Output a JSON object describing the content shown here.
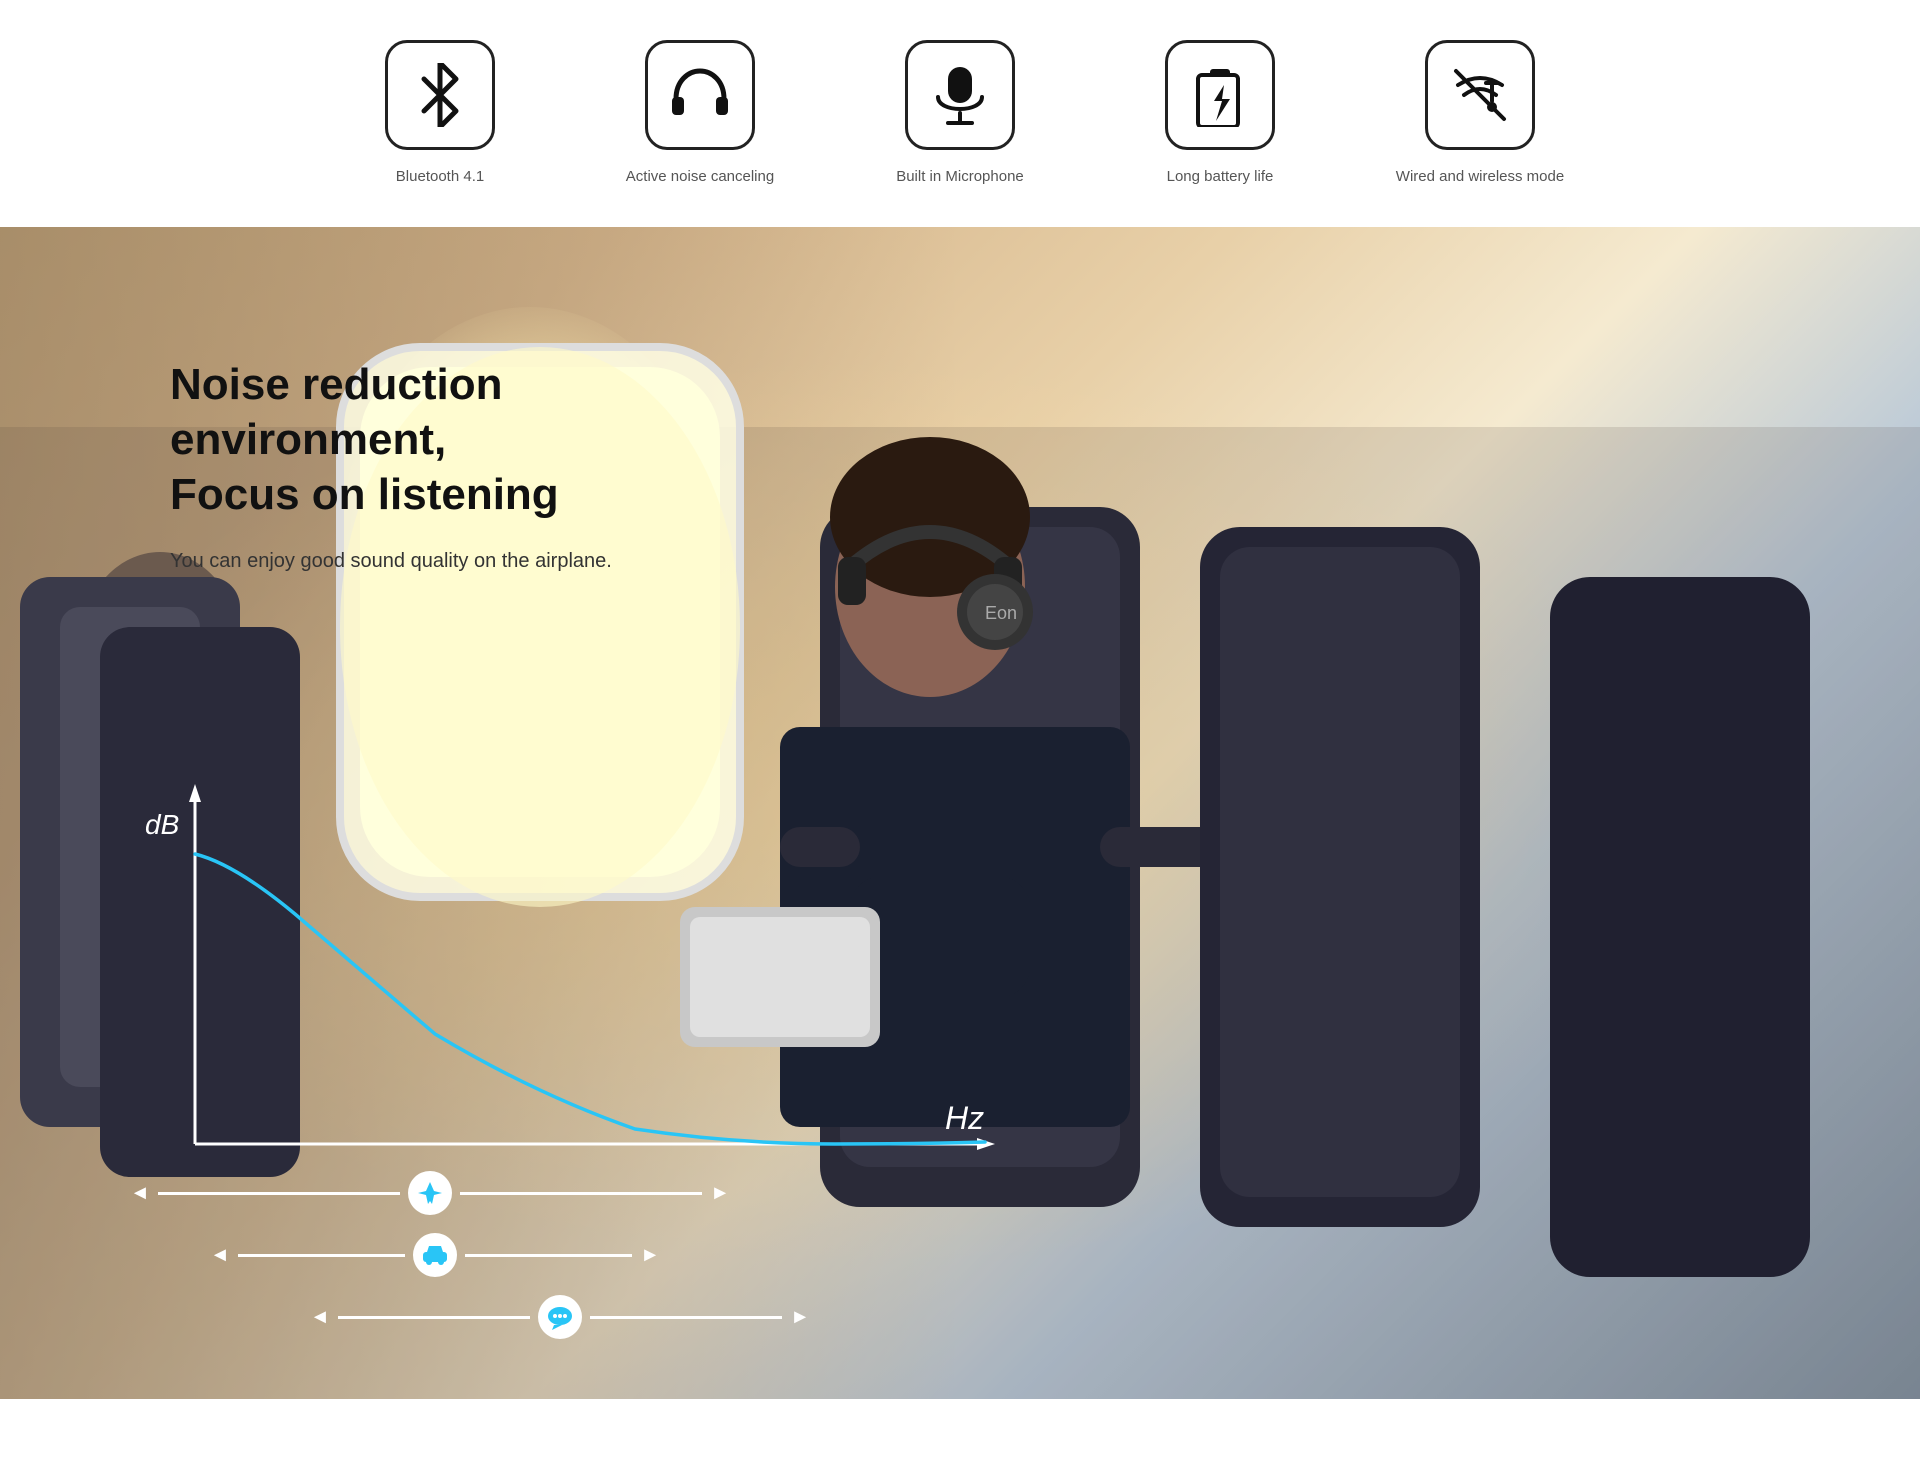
{
  "features": [
    {
      "id": "bluetooth",
      "label": "Bluetooth 4.1",
      "icon": "bluetooth"
    },
    {
      "id": "noise-canceling",
      "label": "Active noise canceling",
      "icon": "headphones"
    },
    {
      "id": "microphone",
      "label": "Built in Microphone",
      "icon": "microphone"
    },
    {
      "id": "battery",
      "label": "Long battery life",
      "icon": "battery"
    },
    {
      "id": "wired-wireless",
      "label": "Wired and wireless mode",
      "icon": "wired-wireless"
    }
  ],
  "main": {
    "headline": "Noise reduction environment,\nFocus on listening",
    "subtext": "You can enjoy good sound quality on the airplane.",
    "db_label": "dB",
    "hz_label": "Hz"
  },
  "ranges": [
    {
      "icon": "airplane",
      "color": "#29aadc"
    },
    {
      "icon": "car",
      "color": "#29aadc"
    },
    {
      "icon": "chat",
      "color": "#29aadc"
    }
  ]
}
